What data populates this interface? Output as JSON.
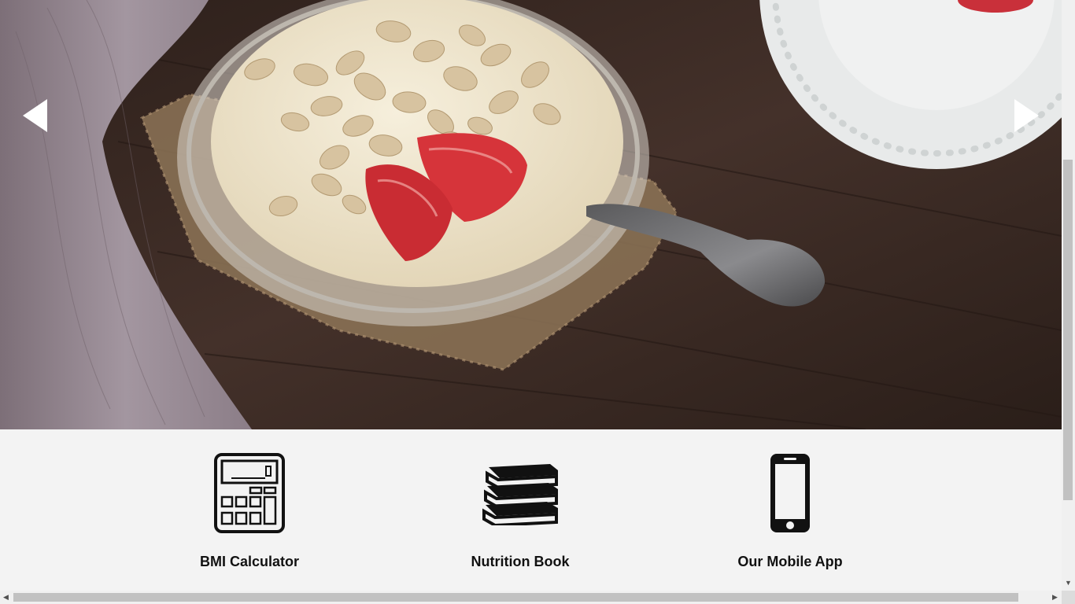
{
  "hero": {
    "image_alt": "Bowl of yogurt with oats and strawberries",
    "prev_icon": "triangle-left-icon",
    "next_icon": "triangle-right-icon"
  },
  "features": [
    {
      "icon": "calculator-icon",
      "title": "BMI Calculator",
      "text": ""
    },
    {
      "icon": "books-icon",
      "title": "Nutrition Book",
      "text": ""
    },
    {
      "icon": "smartphone-icon",
      "title": "Our Mobile App",
      "text": ""
    }
  ],
  "scrollbars": {
    "vertical_icon": "scroll-down-arrow-icon",
    "horizontal_left_icon": "scroll-left-arrow-icon",
    "horizontal_right_icon": "scroll-right-arrow-icon"
  },
  "colors": {
    "wood": "#3a2a22",
    "cloth": "#8f8089",
    "yogurt": "#efe4cc",
    "strawberry": "#d6343a",
    "background": "#f3f3f3",
    "icon": "#111111"
  }
}
